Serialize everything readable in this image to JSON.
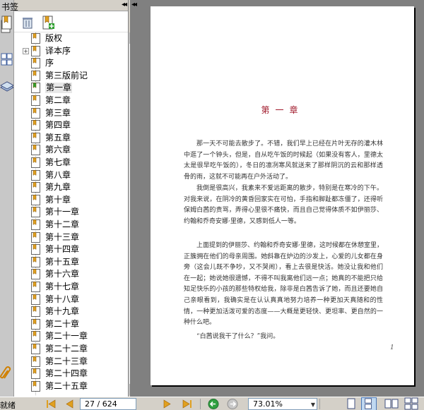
{
  "panel": {
    "title": "书签",
    "collapse_glyph": "◂◂",
    "tools": [
      {
        "name": "bookmark-options-icon"
      },
      {
        "name": "delete-bookmark-icon"
      },
      {
        "name": "new-bookmark-icon"
      }
    ]
  },
  "bookmarks": [
    {
      "label": "版权",
      "expandable": false
    },
    {
      "label": "译本序",
      "expandable": true
    },
    {
      "label": "序",
      "expandable": false
    },
    {
      "label": "第三版前记",
      "expandable": false
    },
    {
      "label": "第一章",
      "expandable": false,
      "selected": true
    },
    {
      "label": "第二章",
      "expandable": false
    },
    {
      "label": "第三章",
      "expandable": false
    },
    {
      "label": "第四章",
      "expandable": false
    },
    {
      "label": "第五章",
      "expandable": false
    },
    {
      "label": "第六章",
      "expandable": false
    },
    {
      "label": "第七章",
      "expandable": false
    },
    {
      "label": "第八章",
      "expandable": false
    },
    {
      "label": "第九章",
      "expandable": false
    },
    {
      "label": "第十章",
      "expandable": false
    },
    {
      "label": "第十一章",
      "expandable": false
    },
    {
      "label": "第十二章",
      "expandable": false
    },
    {
      "label": "第十三章",
      "expandable": false
    },
    {
      "label": "第十四章",
      "expandable": false
    },
    {
      "label": "第十五章",
      "expandable": false
    },
    {
      "label": "第十六章",
      "expandable": false
    },
    {
      "label": "第十七章",
      "expandable": false
    },
    {
      "label": "第十八章",
      "expandable": false
    },
    {
      "label": "第十九章",
      "expandable": false
    },
    {
      "label": "第二十章",
      "expandable": false
    },
    {
      "label": "第二十一章",
      "expandable": false
    },
    {
      "label": "第二十二章",
      "expandable": false
    },
    {
      "label": "第二十三章",
      "expandable": false
    },
    {
      "label": "第二十四章",
      "expandable": false
    },
    {
      "label": "第二十五章",
      "expandable": false
    }
  ],
  "document": {
    "collapse_glyph": "◂◂",
    "chapter_title": "第一章",
    "paragraphs": [
      "那一天不可能去散步了。不错，我们早上已经在片叶无存的灌木林中逛了一个钟头，但是，自从吃午饭的时候起（如果没有客人，里德太太是很早吃午饭的），冬日的凛冽寒风就送来了那样阴沉的云和那样透骨的雨，这就不可能再在户外活动了。",
      "我倒是很高兴，我素来不爱远距离的散步，特别是在寒冷的下午。对我来说，在阴冷的黄昏回家实在可怕，手指和脚趾都冻僵了，还得听保姆白茜的责骂，弄得心里很不痛快，而且自己觉得体质不如伊丽莎、约翰和乔奇安娜·里德，又感到低人一等。",
      "上面提到的伊丽莎、约翰和乔奇安娜·里德，这时候都在休憩室里，正簇拥在他们的母亲周围。她斜靠在炉边的沙发上，心爱的儿女都在身旁（这会儿既不争吵，又不哭闹），看上去很是快活。她没让我和他们在一起；她说她很遗憾，不得不叫我离他们远一点；她真的不能把只给知足快乐的小孩的那些特权给我，除非是白茜告诉了她，而且还要她自己亲眼看到，我确实是在认认真真地努力培养一种更加天真随和的性情，一种更加活泼可爱的态度——大概是更轻快、更坦率、更自然的一种什么吧。",
      "“白茜说我干了什么？”我问。"
    ],
    "page_number": "1"
  },
  "status": {
    "text": "就绪",
    "page_input": "27 / 624",
    "zoom": "73.01%"
  },
  "colors": {
    "chapter_title": "#a0182a",
    "document_background": "#808080",
    "active_view": "#c0d8f0"
  }
}
